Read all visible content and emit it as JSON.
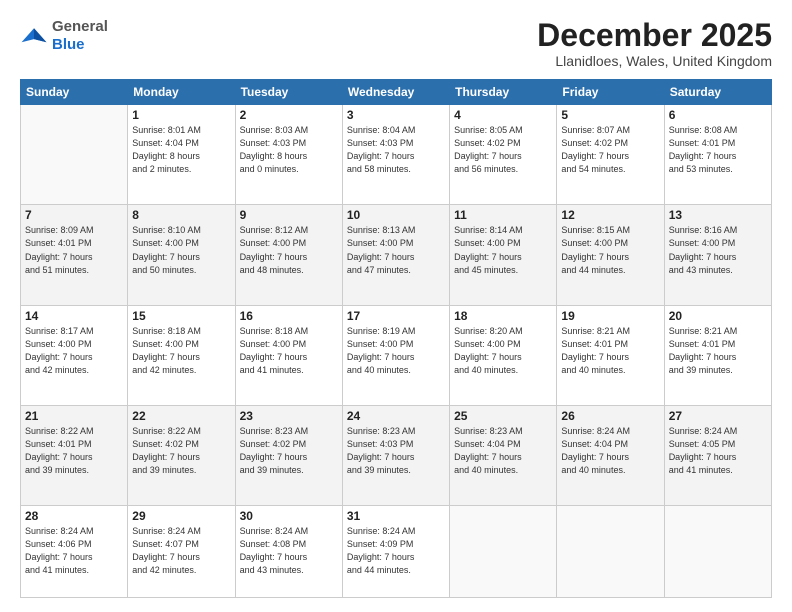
{
  "header": {
    "logo_general": "General",
    "logo_blue": "Blue",
    "title": "December 2025",
    "location": "Llanidloes, Wales, United Kingdom"
  },
  "days_of_week": [
    "Sunday",
    "Monday",
    "Tuesday",
    "Wednesday",
    "Thursday",
    "Friday",
    "Saturday"
  ],
  "weeks": [
    [
      {
        "num": "",
        "info": ""
      },
      {
        "num": "1",
        "info": "Sunrise: 8:01 AM\nSunset: 4:04 PM\nDaylight: 8 hours\nand 2 minutes."
      },
      {
        "num": "2",
        "info": "Sunrise: 8:03 AM\nSunset: 4:03 PM\nDaylight: 8 hours\nand 0 minutes."
      },
      {
        "num": "3",
        "info": "Sunrise: 8:04 AM\nSunset: 4:03 PM\nDaylight: 7 hours\nand 58 minutes."
      },
      {
        "num": "4",
        "info": "Sunrise: 8:05 AM\nSunset: 4:02 PM\nDaylight: 7 hours\nand 56 minutes."
      },
      {
        "num": "5",
        "info": "Sunrise: 8:07 AM\nSunset: 4:02 PM\nDaylight: 7 hours\nand 54 minutes."
      },
      {
        "num": "6",
        "info": "Sunrise: 8:08 AM\nSunset: 4:01 PM\nDaylight: 7 hours\nand 53 minutes."
      }
    ],
    [
      {
        "num": "7",
        "info": "Sunrise: 8:09 AM\nSunset: 4:01 PM\nDaylight: 7 hours\nand 51 minutes."
      },
      {
        "num": "8",
        "info": "Sunrise: 8:10 AM\nSunset: 4:00 PM\nDaylight: 7 hours\nand 50 minutes."
      },
      {
        "num": "9",
        "info": "Sunrise: 8:12 AM\nSunset: 4:00 PM\nDaylight: 7 hours\nand 48 minutes."
      },
      {
        "num": "10",
        "info": "Sunrise: 8:13 AM\nSunset: 4:00 PM\nDaylight: 7 hours\nand 47 minutes."
      },
      {
        "num": "11",
        "info": "Sunrise: 8:14 AM\nSunset: 4:00 PM\nDaylight: 7 hours\nand 45 minutes."
      },
      {
        "num": "12",
        "info": "Sunrise: 8:15 AM\nSunset: 4:00 PM\nDaylight: 7 hours\nand 44 minutes."
      },
      {
        "num": "13",
        "info": "Sunrise: 8:16 AM\nSunset: 4:00 PM\nDaylight: 7 hours\nand 43 minutes."
      }
    ],
    [
      {
        "num": "14",
        "info": "Sunrise: 8:17 AM\nSunset: 4:00 PM\nDaylight: 7 hours\nand 42 minutes."
      },
      {
        "num": "15",
        "info": "Sunrise: 8:18 AM\nSunset: 4:00 PM\nDaylight: 7 hours\nand 42 minutes."
      },
      {
        "num": "16",
        "info": "Sunrise: 8:18 AM\nSunset: 4:00 PM\nDaylight: 7 hours\nand 41 minutes."
      },
      {
        "num": "17",
        "info": "Sunrise: 8:19 AM\nSunset: 4:00 PM\nDaylight: 7 hours\nand 40 minutes."
      },
      {
        "num": "18",
        "info": "Sunrise: 8:20 AM\nSunset: 4:00 PM\nDaylight: 7 hours\nand 40 minutes."
      },
      {
        "num": "19",
        "info": "Sunrise: 8:21 AM\nSunset: 4:01 PM\nDaylight: 7 hours\nand 40 minutes."
      },
      {
        "num": "20",
        "info": "Sunrise: 8:21 AM\nSunset: 4:01 PM\nDaylight: 7 hours\nand 39 minutes."
      }
    ],
    [
      {
        "num": "21",
        "info": "Sunrise: 8:22 AM\nSunset: 4:01 PM\nDaylight: 7 hours\nand 39 minutes."
      },
      {
        "num": "22",
        "info": "Sunrise: 8:22 AM\nSunset: 4:02 PM\nDaylight: 7 hours\nand 39 minutes."
      },
      {
        "num": "23",
        "info": "Sunrise: 8:23 AM\nSunset: 4:02 PM\nDaylight: 7 hours\nand 39 minutes."
      },
      {
        "num": "24",
        "info": "Sunrise: 8:23 AM\nSunset: 4:03 PM\nDaylight: 7 hours\nand 39 minutes."
      },
      {
        "num": "25",
        "info": "Sunrise: 8:23 AM\nSunset: 4:04 PM\nDaylight: 7 hours\nand 40 minutes."
      },
      {
        "num": "26",
        "info": "Sunrise: 8:24 AM\nSunset: 4:04 PM\nDaylight: 7 hours\nand 40 minutes."
      },
      {
        "num": "27",
        "info": "Sunrise: 8:24 AM\nSunset: 4:05 PM\nDaylight: 7 hours\nand 41 minutes."
      }
    ],
    [
      {
        "num": "28",
        "info": "Sunrise: 8:24 AM\nSunset: 4:06 PM\nDaylight: 7 hours\nand 41 minutes."
      },
      {
        "num": "29",
        "info": "Sunrise: 8:24 AM\nSunset: 4:07 PM\nDaylight: 7 hours\nand 42 minutes."
      },
      {
        "num": "30",
        "info": "Sunrise: 8:24 AM\nSunset: 4:08 PM\nDaylight: 7 hours\nand 43 minutes."
      },
      {
        "num": "31",
        "info": "Sunrise: 8:24 AM\nSunset: 4:09 PM\nDaylight: 7 hours\nand 44 minutes."
      },
      {
        "num": "",
        "info": ""
      },
      {
        "num": "",
        "info": ""
      },
      {
        "num": "",
        "info": ""
      }
    ]
  ]
}
